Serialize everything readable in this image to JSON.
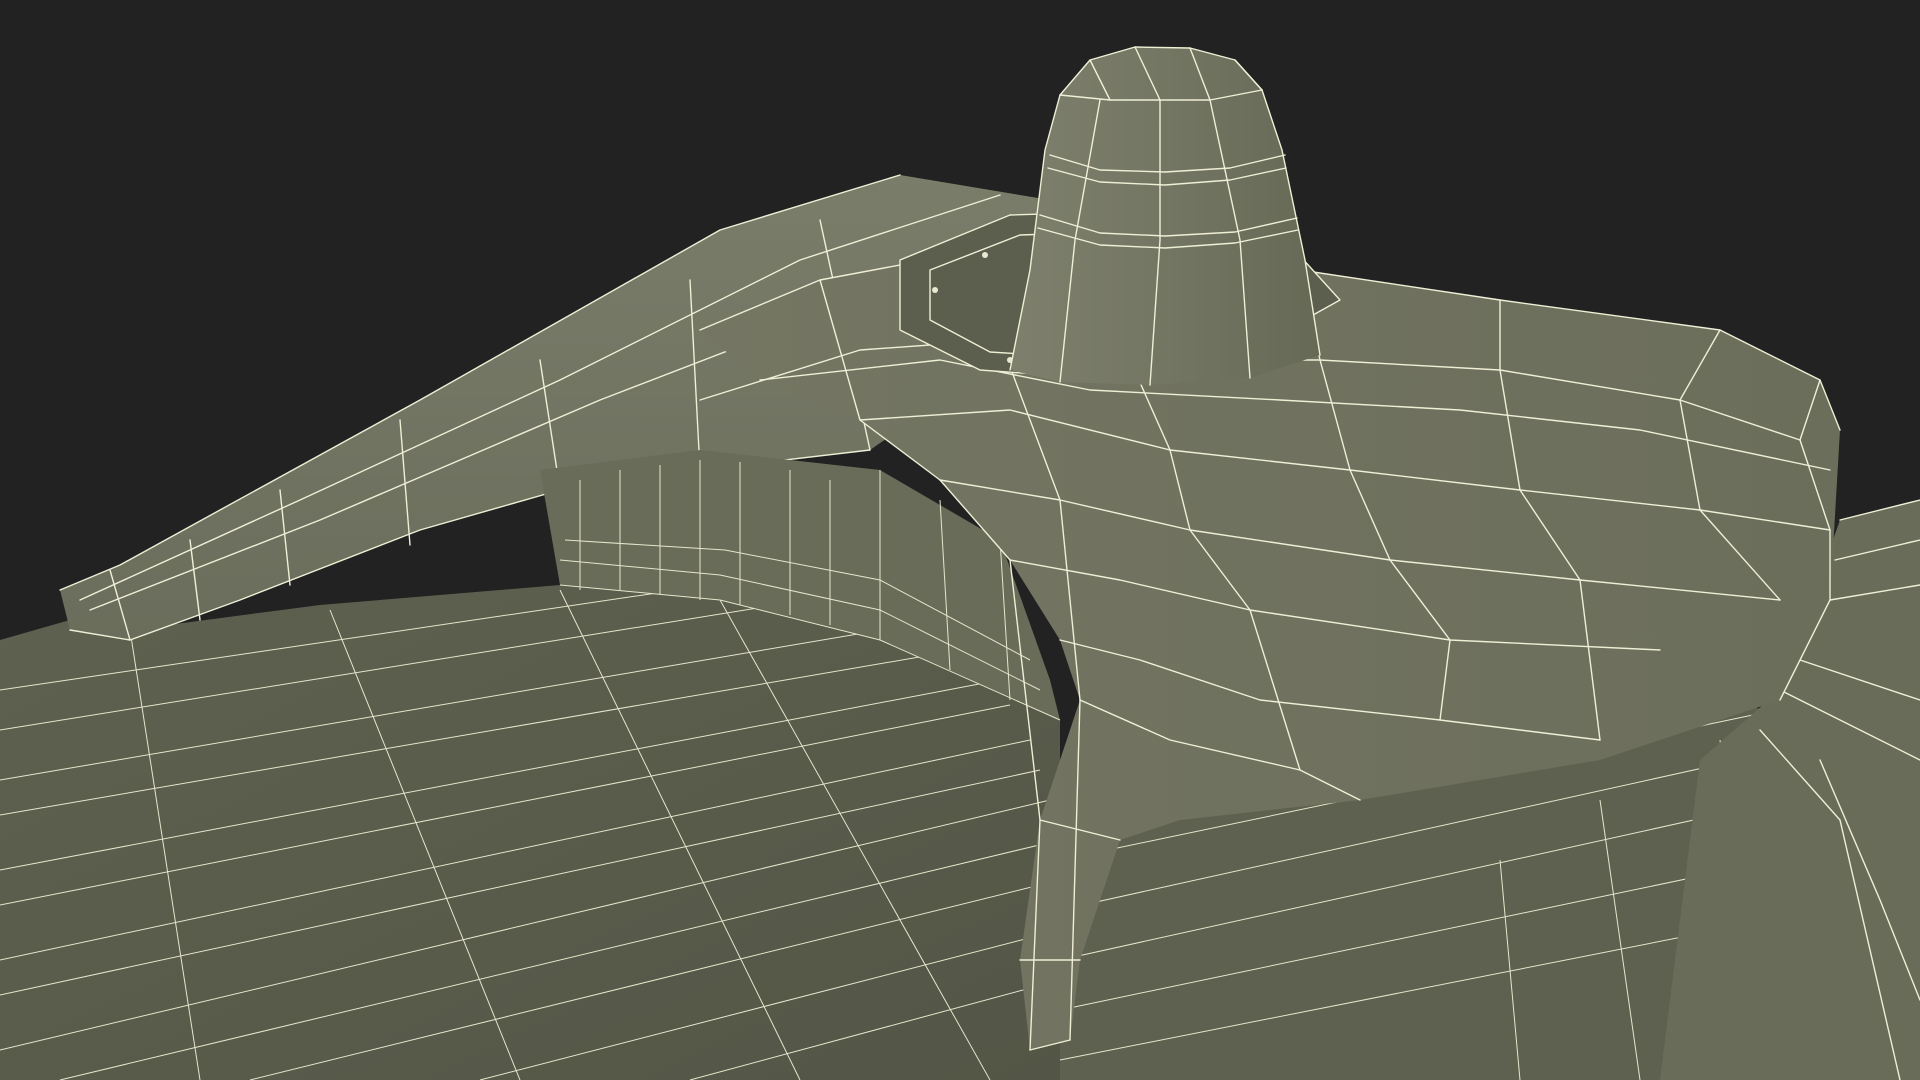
{
  "scene": {
    "subject": "wireframe-3d-model-render",
    "colors": {
      "background": "#222222",
      "surface_dark": "#5e604f",
      "surface_mid": "#6f7160",
      "surface_light": "#7b7d6b",
      "wire": "#efefd6"
    }
  }
}
